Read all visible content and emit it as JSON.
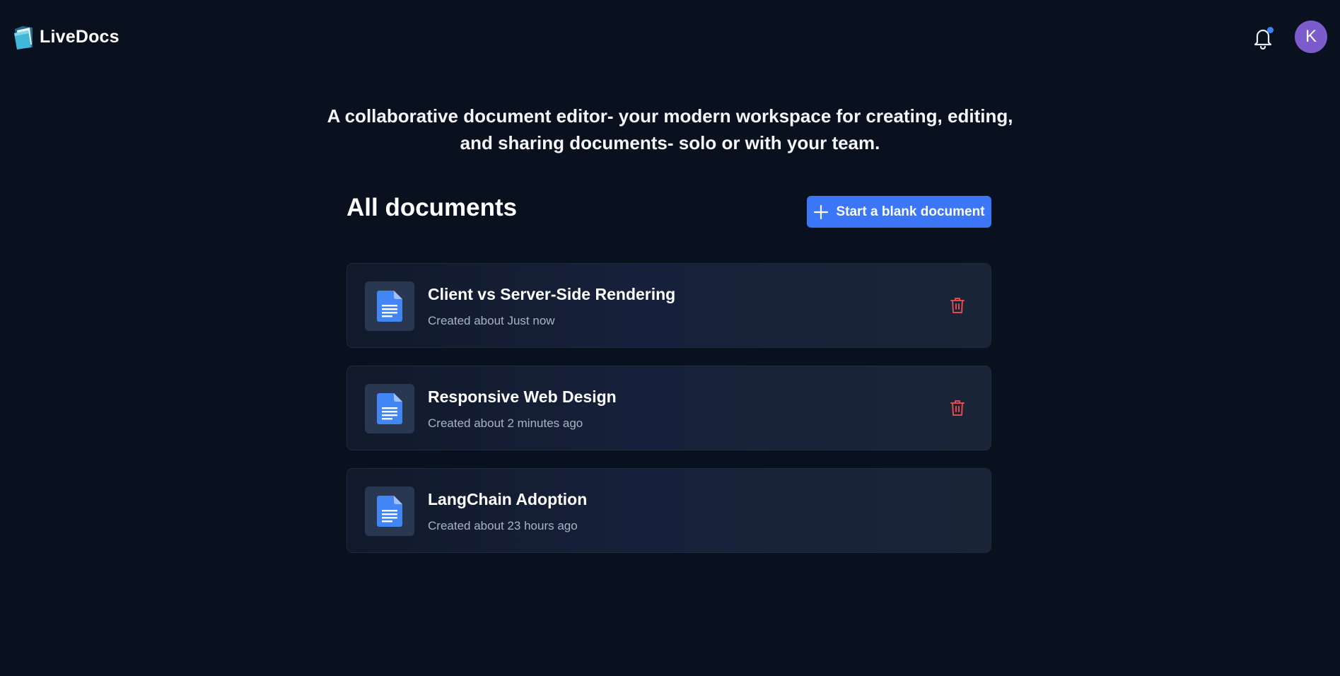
{
  "app": {
    "name": "LiveDocs",
    "logo_icon": "folder-logo-icon"
  },
  "header": {
    "notification_icon": "bell-icon",
    "has_unread": true,
    "avatar_initial": "K",
    "avatar_color": "#7c5ccc"
  },
  "hero": {
    "tagline": "A collaborative document editor- your modern workspace for creating, editing, and sharing documents- solo or with your team."
  },
  "documents": {
    "section_title": "All documents",
    "new_button_label": "Start a blank document",
    "new_button_icon": "plus-icon",
    "items": [
      {
        "title": "Client vs Server-Side Rendering",
        "meta": "Created about Just now",
        "deletable": true
      },
      {
        "title": "Responsive Web Design",
        "meta": "Created about 2 minutes ago",
        "deletable": true
      },
      {
        "title": "LangChain Adoption",
        "meta": "Created about 23 hours ago",
        "deletable": false
      }
    ]
  },
  "colors": {
    "background": "#09111f",
    "accent": "#3b76f6",
    "danger": "#e5484d",
    "doc_icon": "#4285f4"
  }
}
